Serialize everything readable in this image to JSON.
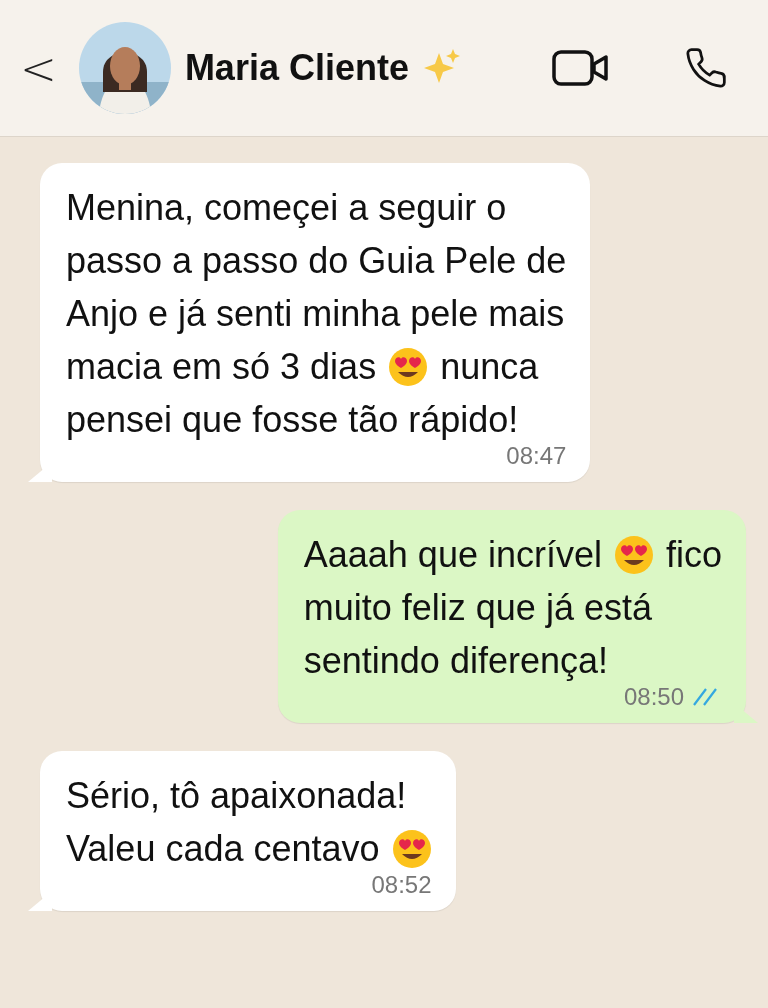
{
  "header": {
    "back": "<",
    "contact_name": "Maria Cliente"
  },
  "messages": [
    {
      "kind": "incoming",
      "time": "08:47",
      "lines": [
        [
          {
            "kind": "text",
            "text": "Menina, começei a seguir o"
          }
        ],
        [
          {
            "kind": "text",
            "text": "passo a passo do Guia Pele de"
          }
        ],
        [
          {
            "kind": "text",
            "text": "Anjo e já senti minha pele mais"
          }
        ],
        [
          {
            "kind": "text",
            "text": "macia em só 3 dias"
          },
          {
            "kind": "emoji"
          },
          {
            "kind": "text",
            "text": "nunca"
          }
        ],
        [
          {
            "kind": "text",
            "text": "pensei que fosse tão rápido!"
          }
        ]
      ]
    },
    {
      "kind": "outgoing",
      "time": "08:50",
      "read": true,
      "lines": [
        [
          {
            "kind": "text",
            "text": "Aaaah que incrível"
          },
          {
            "kind": "emoji"
          },
          {
            "kind": "text",
            "text": "fico"
          }
        ],
        [
          {
            "kind": "text",
            "text": "muito feliz que já está"
          }
        ],
        [
          {
            "kind": "text",
            "text": "sentindo diferença!"
          }
        ]
      ]
    },
    {
      "kind": "incoming",
      "time": "08:52",
      "lines": [
        [
          {
            "kind": "text",
            "text": "Sério, tô apaixonada!"
          }
        ],
        [
          {
            "kind": "text",
            "text": "Valeu cada centavo"
          },
          {
            "kind": "emoji"
          }
        ]
      ]
    }
  ]
}
